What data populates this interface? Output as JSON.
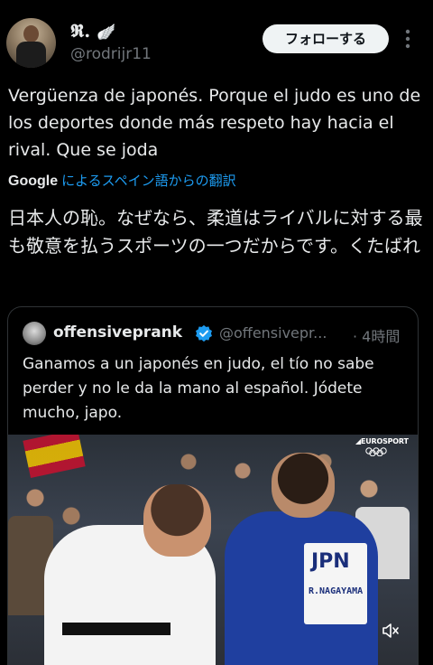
{
  "author": {
    "display_name": "𝕽.",
    "handle": "@rodrijr11",
    "name_emoji": "🪽"
  },
  "follow_button": {
    "label": "フォローする"
  },
  "tweet": {
    "text": "Vergüenza de japonés. Porque el judo es uno de los deportes donde más respeto hay hacia el rival. Que se joda"
  },
  "translation": {
    "provider": "Google",
    "label": "によるスペイン語からの翻訳",
    "text": "日本人の恥。なぜなら、柔道はライバルに対する最も敬意を払うスポーツの一つだからです。くたばれ"
  },
  "quoted_tweet": {
    "display_name": "offensiveprank",
    "handle": "@offensivepr...",
    "time": "· 4時間",
    "text": "Ganamos a un japonés en judo, el tío no sabe perder y no le da la mano al español. Jódete mucho, japo."
  },
  "video": {
    "broadcaster": "◢EUROSPORT",
    "back_patch_country": "JPN",
    "back_patch_name": "R.NAGAYAMA"
  },
  "colors": {
    "background": "#000000",
    "text": "#e7e9ea",
    "muted": "#71767b",
    "link": "#1d9bf0",
    "verified": "#1d9bf0",
    "follow_bg": "#eff3f4"
  },
  "icons": {
    "more": "more-vertical-icon",
    "verified": "verified-badge-icon",
    "mute": "speaker-muted-icon"
  }
}
